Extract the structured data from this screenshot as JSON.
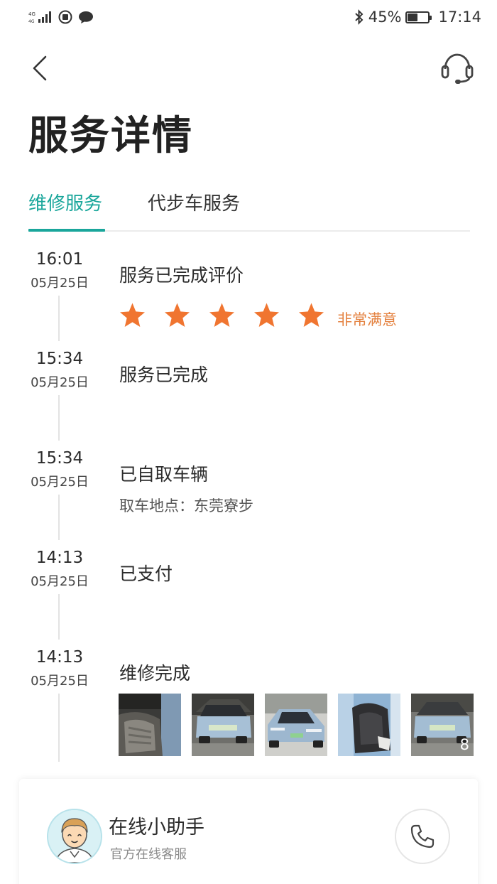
{
  "status_bar": {
    "network": "4G",
    "battery": "45%",
    "battery_level": 0.45,
    "time": "17:14",
    "icons": [
      "signal-icon",
      "notification-icon",
      "chat-icon",
      "bluetooth-icon",
      "battery-icon"
    ]
  },
  "nav": {
    "back_icon": "back-arrow-icon",
    "support_icon": "headset-icon"
  },
  "page_title": "服务详情",
  "tabs": [
    {
      "label": "维修服务",
      "active": true
    },
    {
      "label": "代步车服务",
      "active": false
    }
  ],
  "timeline": [
    {
      "time": "16:01",
      "date": "05月25日",
      "title": "服务已完成评价",
      "rating": 5,
      "rating_text": "非常满意"
    },
    {
      "time": "15:34",
      "date": "05月25日",
      "title": "服务已完成"
    },
    {
      "time": "15:34",
      "date": "05月25日",
      "title": "已自取车辆",
      "subtitle": "取车地点：东莞寮步"
    },
    {
      "time": "14:13",
      "date": "05月25日",
      "title": "已支付"
    },
    {
      "time": "14:13",
      "date": "05月25日",
      "title": "维修完成",
      "photos_extra_count": "8"
    }
  ],
  "colors": {
    "accent": "#1aa69b",
    "star": "#f07530",
    "rating_text": "#e4813f"
  },
  "assistant": {
    "name": "在线小助手",
    "subtitle": "官方在线客服",
    "call_icon": "phone-icon"
  }
}
